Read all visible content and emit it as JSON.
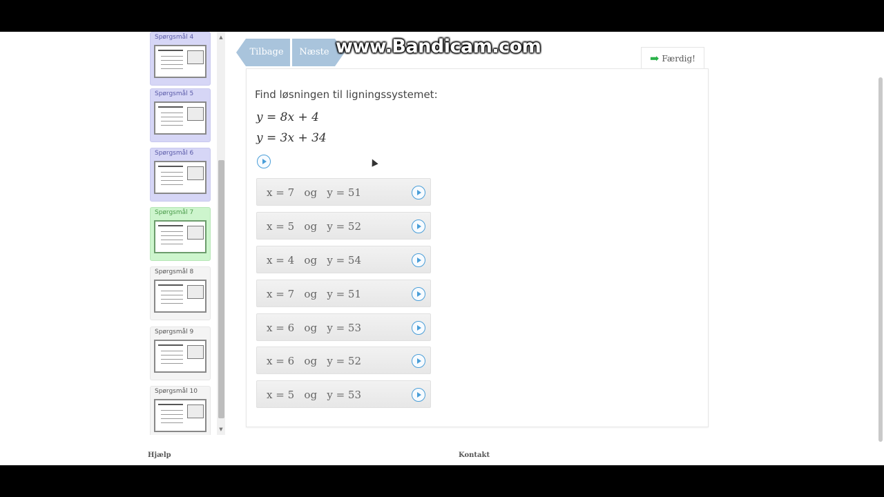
{
  "watermark": "www.Bandicam.com",
  "nav": {
    "back_label": "Tilbage",
    "next_label": "Næste"
  },
  "finish": {
    "label": "Færdig!",
    "icon": "arrow-right-icon"
  },
  "sidebar": {
    "items": [
      {
        "label": "Spørgsmål 4",
        "state": "answered"
      },
      {
        "label": "Spørgsmål 5",
        "state": "answered"
      },
      {
        "label": "Spørgsmål 6",
        "state": "answered"
      },
      {
        "label": "Spørgsmål 7",
        "state": "current"
      },
      {
        "label": "Spørgsmål 8",
        "state": "unanswered"
      },
      {
        "label": "Spørgsmål 9",
        "state": "unanswered"
      },
      {
        "label": "Spørgsmål 10",
        "state": "unanswered"
      }
    ]
  },
  "question": {
    "prompt": "Find løsningen til ligningssystemet:",
    "equation1": "y = 8x + 4",
    "equation2": "y = 3x + 34"
  },
  "answers": [
    "x = 7   og   y = 51",
    "x = 5   og   y = 52",
    "x = 4   og   y = 54",
    "x = 7   og   y = 51",
    "x = 6   og   y = 53",
    "x = 6   og   y = 52",
    "x = 5   og   y = 53"
  ],
  "footer": {
    "help": "Hjælp",
    "contact": "Kontakt"
  },
  "colors": {
    "answered": "#d6d6f6",
    "current": "#cdf5cd",
    "nav": "#a9c4dc",
    "play": "#4a9ed8",
    "finish_arrow": "#2bb24a"
  }
}
